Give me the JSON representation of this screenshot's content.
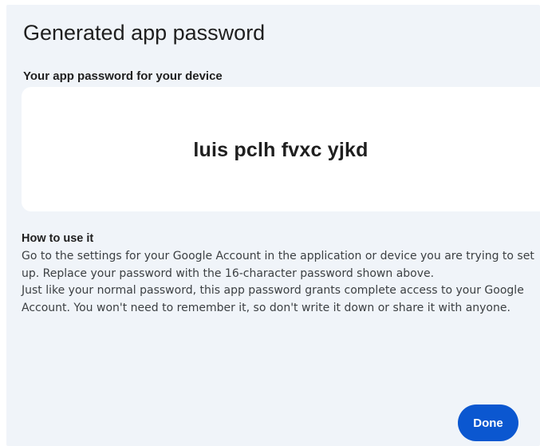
{
  "dialog": {
    "title": "Generated app password",
    "subtitle": "Your app password for your device",
    "password": "luis pclh fvxc yjkd",
    "howto": {
      "heading": "How to use it",
      "paragraph1": "Go to the settings for your Google Account in the application or device you are trying to set up. Replace your password with the 16-character password shown above.",
      "paragraph2": "Just like your normal password, this app password grants complete access to your Google Account. You won't need to remember it, so don't write it down or share it with anyone."
    },
    "done_label": "Done"
  },
  "colors": {
    "dialog_background": "#f0f4f9",
    "card_background": "#ffffff",
    "primary_button": "#0b57d0",
    "text_primary": "#1f1f1f",
    "text_secondary": "#3c4043"
  }
}
